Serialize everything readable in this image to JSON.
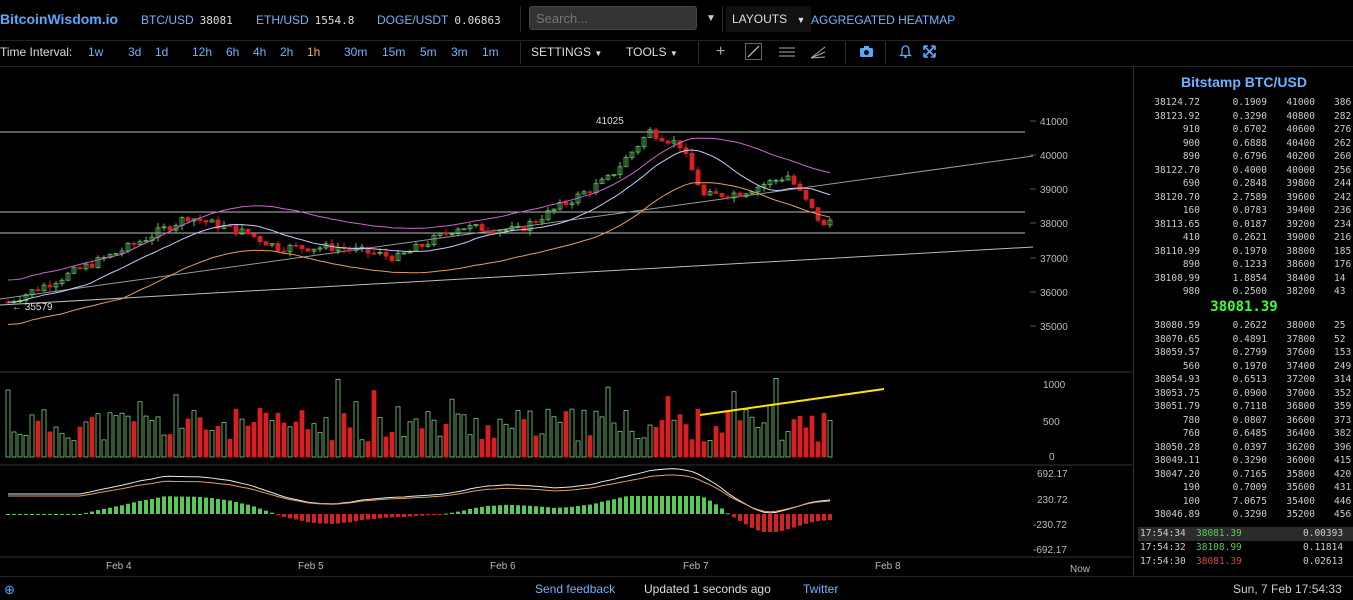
{
  "topbar": {
    "logo": "BitcoinWisdom.io",
    "tickers": [
      {
        "symbol": "BTC/USD",
        "price": "38081"
      },
      {
        "symbol": "ETH/USD",
        "price": "1554.8"
      },
      {
        "symbol": "DOGE/USDT",
        "price": "0.06863"
      }
    ],
    "search_placeholder": "Search...",
    "layouts_label": "LAYOUTS",
    "aggregated_label": "AGGREGATED HEATMAP"
  },
  "toolbar": {
    "time_interval_label": "Time Interval:",
    "intervals": [
      "1w",
      "3d",
      "1d",
      "12h",
      "6h",
      "4h",
      "2h",
      "1h",
      "30m",
      "15m",
      "5m",
      "3m",
      "1m"
    ],
    "active_interval": "1h",
    "settings_label": "SETTINGS",
    "tools_label": "TOOLS"
  },
  "chart": {
    "price_axis": [
      "41000",
      "40000",
      "39000",
      "38000",
      "37000",
      "36000",
      "35000"
    ],
    "volume_axis": [
      "1000",
      "500",
      "0"
    ],
    "macd_axis": [
      "692.17",
      "230.72",
      "-230.72",
      "-692.17"
    ],
    "date_axis": [
      "Feb 4",
      "Feb 5",
      "Feb 6",
      "Feb 7",
      "Feb 8",
      "Now"
    ],
    "high_marker": "41025",
    "low_marker": "35579",
    "colors": {
      "up": "#5fc25f",
      "down": "#d42121",
      "volume_up": "#7fd17f",
      "trendline": "#ffe600"
    }
  },
  "sidebar": {
    "title": "Bitstamp BTC/USD",
    "asks": [
      [
        "38124.72",
        "0.1909",
        "41000",
        "386"
      ],
      [
        "38123.92",
        "0.3290",
        "40800",
        "282"
      ],
      [
        "910",
        "0.6702",
        "40600",
        "276"
      ],
      [
        "900",
        "0.6888",
        "40400",
        "262"
      ],
      [
        "890",
        "0.6796",
        "40200",
        "260"
      ],
      [
        "38122.70",
        "0.4000",
        "40000",
        "256"
      ],
      [
        "690",
        "0.2848",
        "39800",
        "244"
      ],
      [
        "38120.70",
        "2.7589",
        "39600",
        "242"
      ],
      [
        "160",
        "0.0783",
        "39400",
        "236"
      ],
      [
        "38113.65",
        "0.0187",
        "39200",
        "234"
      ],
      [
        "410",
        "0.2621",
        "39000",
        "216"
      ],
      [
        "38110.99",
        "0.1970",
        "38800",
        "185"
      ],
      [
        "890",
        "0.1233",
        "38600",
        "176"
      ],
      [
        "38108.99",
        "1.8854",
        "38400",
        "14"
      ],
      [
        "980",
        "0.2500",
        "38200",
        "43"
      ]
    ],
    "last_price": "38081.39",
    "bids": [
      [
        "38080.59",
        "0.2622",
        "38000",
        "25"
      ],
      [
        "38070.65",
        "0.4891",
        "37800",
        "52"
      ],
      [
        "38059.57",
        "0.2799",
        "37600",
        "153"
      ],
      [
        "560",
        "0.1970",
        "37400",
        "249"
      ],
      [
        "38054.93",
        "0.6513",
        "37200",
        "314"
      ],
      [
        "38053.75",
        "0.0900",
        "37000",
        "352"
      ],
      [
        "38051.79",
        "0.7118",
        "36800",
        "359"
      ],
      [
        "780",
        "0.0807",
        "36600",
        "373"
      ],
      [
        "760",
        "0.6485",
        "36400",
        "382"
      ],
      [
        "38050.28",
        "0.0397",
        "36200",
        "396"
      ],
      [
        "38049.11",
        "0.3290",
        "36000",
        "415"
      ],
      [
        "38047.20",
        "0.7165",
        "35800",
        "420"
      ],
      [
        "190",
        "0.7009",
        "35600",
        "431"
      ],
      [
        "100",
        "7.0675",
        "35400",
        "446"
      ],
      [
        "38046.89",
        "0.3290",
        "35200",
        "456"
      ]
    ],
    "trades": [
      {
        "time": "17:54:34",
        "price": "38081.39",
        "amount": "0.00393",
        "dir": "up"
      },
      {
        "time": "17:54:32",
        "price": "38108.99",
        "amount": "0.11814",
        "dir": "up"
      },
      {
        "time": "17:54:30",
        "price": "38081.39",
        "amount": "0.02613",
        "dir": "down"
      }
    ]
  },
  "footer": {
    "feedback": "Send feedback",
    "updated": "Updated 1 seconds ago",
    "twitter": "Twitter",
    "datetime": "Sun, 7 Feb 17:54:33"
  }
}
